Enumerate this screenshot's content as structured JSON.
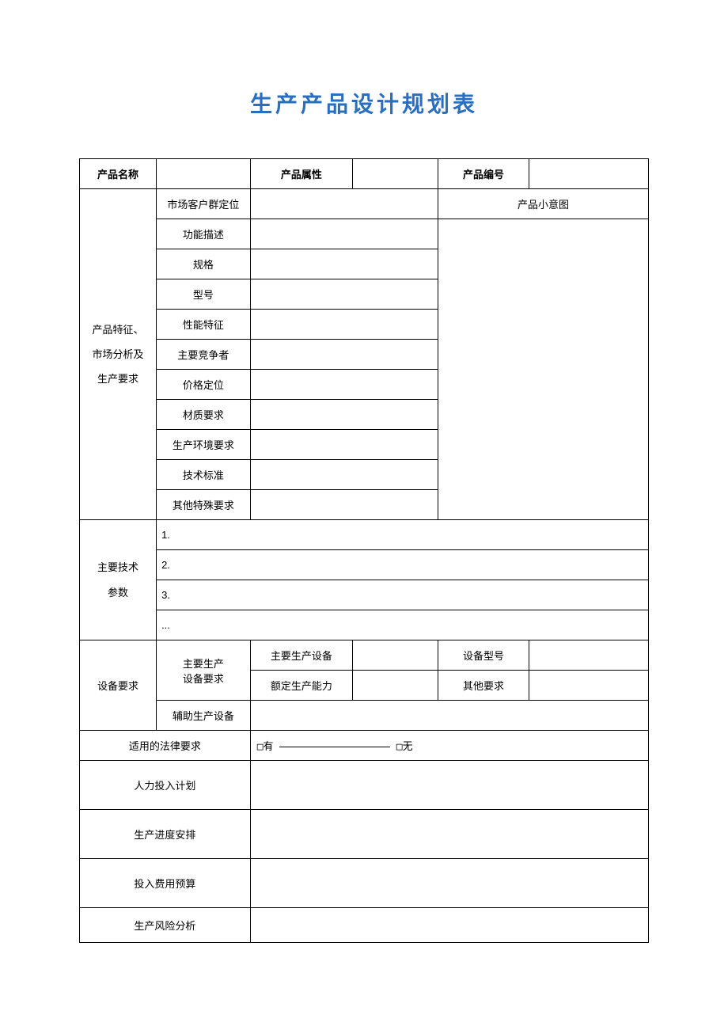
{
  "title": "生产产品设计规划表",
  "row1": {
    "productName": "产品名称",
    "productAttr": "产品属性",
    "productNo": "产品编号"
  },
  "features": {
    "sectionLabel1": "产品特征、",
    "sectionLabel2": "市场分析及",
    "sectionLabel3": "生产要求",
    "marketPosition": "市场客户群定位",
    "thumbnail": "产品小意图",
    "functionDesc": "功能描述",
    "spec": "规格",
    "model": "型号",
    "perfFeature": "性能特征",
    "competitor": "主要竞争者",
    "pricePosition": "价格定位",
    "materialReq": "材质要求",
    "envReq": "生产环境要求",
    "techStd": "技术标准",
    "otherSpecial": "其他特殊要求"
  },
  "techParams": {
    "label1": "主要技术",
    "label2": "参数",
    "item1": "1.",
    "item2": "2.",
    "item3": "3.",
    "itemMore": "..."
  },
  "equipment": {
    "label": "设备要求",
    "mainEquipLabel1": "主要生产",
    "mainEquipLabel2": "设备要求",
    "mainEquip": "主要生产设备",
    "equipModel": "设备型号",
    "ratedCapacity": "额定生产能力",
    "otherReq": "其他要求",
    "auxEquip": "辅助生产设备"
  },
  "legal": {
    "label": "适用的法律要求",
    "has": "□有",
    "none": "□无"
  },
  "manpower": "人力投入计划",
  "schedule": "生产进度安排",
  "budget": "投入费用预算",
  "risk": "生产风险分析"
}
